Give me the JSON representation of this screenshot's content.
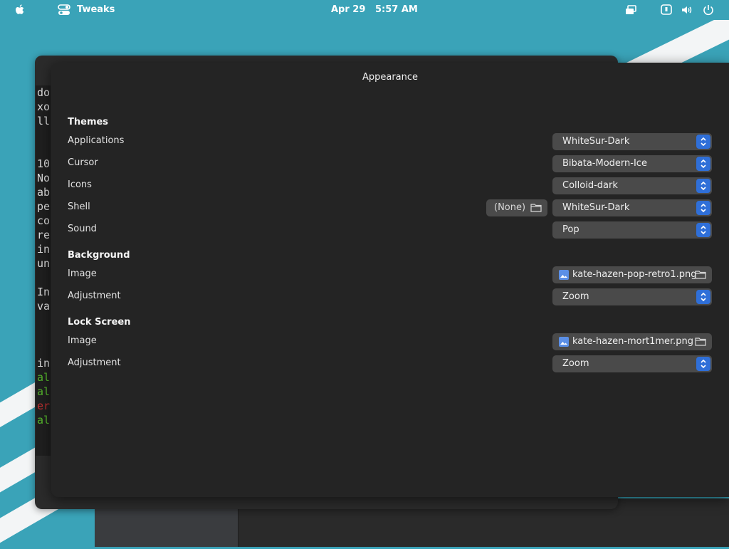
{
  "topbar": {
    "app_name": "Tweaks",
    "date": "Apr 29",
    "time": "5:57 AM",
    "icons": [
      "apple-icon",
      "tweaks-app-icon",
      "window-switch-icon",
      "accessibility-icon",
      "volume-icon",
      "power-icon"
    ]
  },
  "terminal": {
    "lines": [
      "do",
      "xo",
      "ll",
      "",
      "",
      "10",
      "No",
      "ab",
      "pe",
      "co",
      "re",
      "in",
      "un",
      "",
      "In",
      "va",
      "",
      "",
      "",
      "in",
      "al",
      "al",
      "er",
      "al"
    ],
    "colors": {
      "green": "#55b62c",
      "red": "#c23030"
    }
  },
  "window": {
    "title": "Appearance",
    "sections": {
      "themes": {
        "header": "Themes",
        "applications": {
          "label": "Applications",
          "value": "WhiteSur-Dark"
        },
        "cursor": {
          "label": "Cursor",
          "value": "Bibata-Modern-Ice"
        },
        "icons": {
          "label": "Icons",
          "value": "Colloid-dark"
        },
        "shell": {
          "label": "Shell",
          "value": "WhiteSur-Dark",
          "file_value": "(None)"
        },
        "sound": {
          "label": "Sound",
          "value": "Pop"
        }
      },
      "background": {
        "header": "Background",
        "image": {
          "label": "Image",
          "file": "kate-hazen-pop-retro1.png"
        },
        "adjustment": {
          "label": "Adjustment",
          "value": "Zoom"
        }
      },
      "lock_screen": {
        "header": "Lock Screen",
        "image": {
          "label": "Image",
          "file": "kate-hazen-mort1mer.png"
        },
        "adjustment": {
          "label": "Adjustment",
          "value": "Zoom"
        }
      }
    }
  },
  "colors": {
    "accent": "#2f6fd8",
    "panel": "#3aa3b8",
    "window_bg": "#242424",
    "control_bg": "#4a4a4a"
  }
}
